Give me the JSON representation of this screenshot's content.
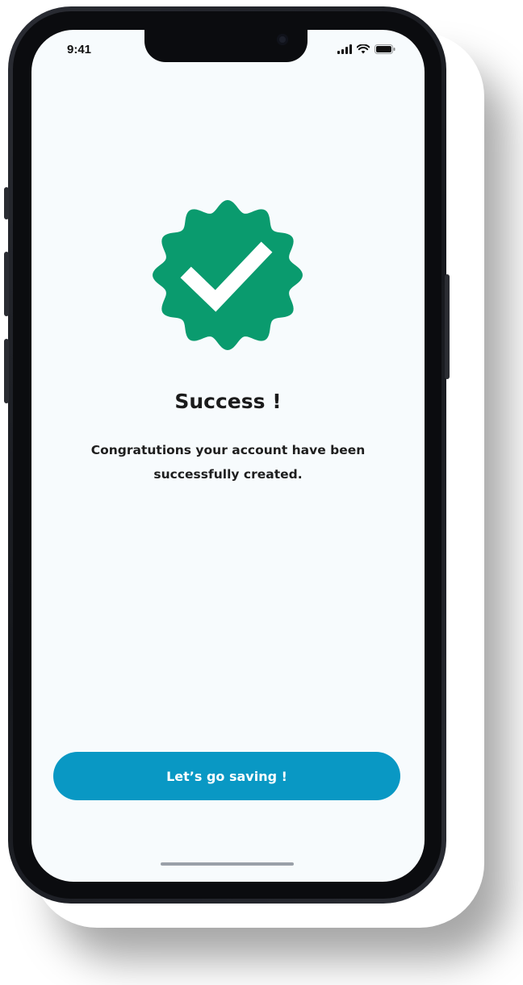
{
  "status_bar": {
    "time": "9:41",
    "icons": [
      "signal-icon",
      "wifi-icon",
      "battery-icon"
    ]
  },
  "success": {
    "badge_icon": "verified-check-badge-icon",
    "badge_color": "#0a9b6e",
    "title": "Success !",
    "message": "Congratutions your account have been successfully created."
  },
  "actions": {
    "primary_label": "Let’s go saving !",
    "primary_color": "#0998c4"
  }
}
